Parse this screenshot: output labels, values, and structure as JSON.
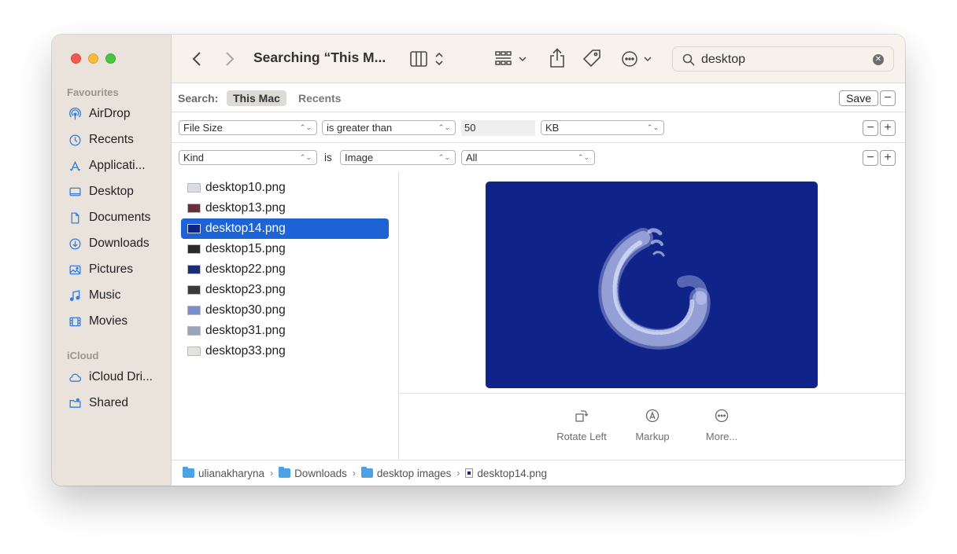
{
  "window": {
    "title": "Searching “This M...",
    "search_value": "desktop",
    "search_placeholder": "Search"
  },
  "sidebar": {
    "favourites_title": "Favourites",
    "favourites": [
      {
        "label": "AirDrop",
        "icon": "airdrop-icon"
      },
      {
        "label": "Recents",
        "icon": "clock-icon"
      },
      {
        "label": "Applicati...",
        "icon": "applications-icon"
      },
      {
        "label": "Desktop",
        "icon": "desktop-icon"
      },
      {
        "label": "Documents",
        "icon": "document-icon"
      },
      {
        "label": "Downloads",
        "icon": "download-icon"
      },
      {
        "label": "Pictures",
        "icon": "pictures-icon"
      },
      {
        "label": "Music",
        "icon": "music-icon"
      },
      {
        "label": "Movies",
        "icon": "film-icon"
      }
    ],
    "icloud_title": "iCloud",
    "icloud": [
      {
        "label": "iCloud Dri...",
        "icon": "cloud-icon"
      },
      {
        "label": "Shared",
        "icon": "shared-folder-icon"
      }
    ]
  },
  "scope": {
    "label": "Search:",
    "options": [
      "This Mac",
      "Recents"
    ],
    "active": "This Mac",
    "save_label": "Save",
    "minus": "−"
  },
  "criteria": [
    {
      "attribute": "File Size",
      "operator": "is greater than",
      "value": "50",
      "unit": "KB"
    },
    {
      "attribute": "Kind",
      "is_label": "is",
      "operator": "Image",
      "value": "All"
    }
  ],
  "files": [
    {
      "name": "desktop10.png",
      "thumb": "#d9dde6"
    },
    {
      "name": "desktop13.png",
      "thumb": "#6a2f3a"
    },
    {
      "name": "desktop14.png",
      "thumb": "#0f2389"
    },
    {
      "name": "desktop15.png",
      "thumb": "#2a2a2a"
    },
    {
      "name": "desktop22.png",
      "thumb": "#1a2e78"
    },
    {
      "name": "desktop23.png",
      "thumb": "#3a3a3a"
    },
    {
      "name": "desktop30.png",
      "thumb": "#7c8cc7"
    },
    {
      "name": "desktop31.png",
      "thumb": "#9aa5b8"
    },
    {
      "name": "desktop33.png",
      "thumb": "#e5e2dd"
    }
  ],
  "selected_file": "desktop14.png",
  "actions": [
    "Rotate Left",
    "Markup",
    "More..."
  ],
  "path": [
    "ulianakharyna",
    "Downloads",
    "desktop images",
    "desktop14.png"
  ],
  "colors": {
    "accent": "#1d63d6",
    "folder": "#4da2e6",
    "preview_bg": "#0f2389"
  }
}
